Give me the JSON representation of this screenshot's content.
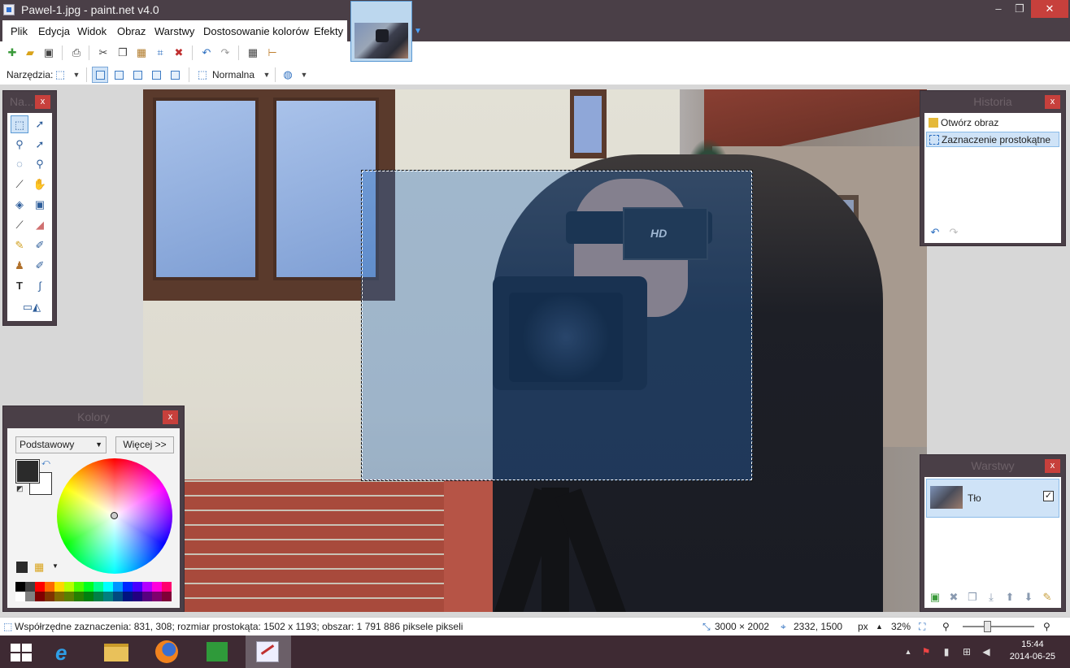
{
  "window": {
    "title": "Pawel-1.jpg - paint.net v4.0",
    "minimize_glyph": "–",
    "maximize_glyph": "❐",
    "close_glyph": "✕"
  },
  "menu": {
    "items": [
      "Plik",
      "Edycja",
      "Widok",
      "Obraz",
      "Warstwy",
      "Dostosowanie kolorów",
      "Efekty"
    ]
  },
  "toolbar": {
    "tools_label": "Narzędzia:",
    "blend_mode": "Normalna"
  },
  "panels": {
    "tools": {
      "title": "Na...",
      "close": "x"
    },
    "history": {
      "title": "Historia",
      "close": "x",
      "items": [
        "Otwórz obraz",
        "Zaznaczenie prostokątne"
      ]
    },
    "colors": {
      "title": "Kolory",
      "close": "x",
      "palette_mode": "Podstawowy",
      "more_button": "Więcej >>",
      "primary_color": "#2b2b2b",
      "secondary_color": "#ffffff"
    },
    "layers": {
      "title": "Warstwy",
      "close": "x",
      "layer_name": "Tło",
      "visible": "✓"
    }
  },
  "image": {
    "camera_screen_text": "HD"
  },
  "statusbar": {
    "selection_info": "Współrzędne zaznaczenia: 831, 308; rozmiar prostokąta: 1502 x 1193; obszar: 1 791 886 piksele pikseli",
    "image_size": "3000 × 2002",
    "cursor_position": "2332, 1500",
    "unit": "px",
    "zoom": "32%"
  },
  "taskbar": {
    "time": "15:44",
    "date": "2014-06-25"
  },
  "colors": {
    "chrome": "#4a3f47",
    "selection_fill": "#286ebe",
    "close_red": "#c7403c",
    "highlight": "#cfe3f7"
  },
  "icons": {
    "toolbar_row1": [
      "new-image-icon",
      "open-icon",
      "save-icon",
      "print-icon",
      "cut-icon",
      "copy-icon",
      "paste-icon",
      "crop-icon",
      "deselect-icon",
      "undo-icon",
      "redo-icon",
      "grid-icon",
      "ruler-icon"
    ],
    "tools": [
      "rectangle-select-icon",
      "move-selection-icon",
      "lasso-icon",
      "move-selected-icon",
      "ellipse-select-icon",
      "zoom-icon",
      "magic-wand-icon",
      "pan-icon",
      "paint-bucket-icon",
      "gradient-icon",
      "paintbrush-icon",
      "eraser-icon",
      "pencil-icon",
      "color-picker-icon",
      "clone-stamp-icon",
      "recolor-icon",
      "text-icon",
      "line-icon",
      "shapes-icon"
    ]
  }
}
